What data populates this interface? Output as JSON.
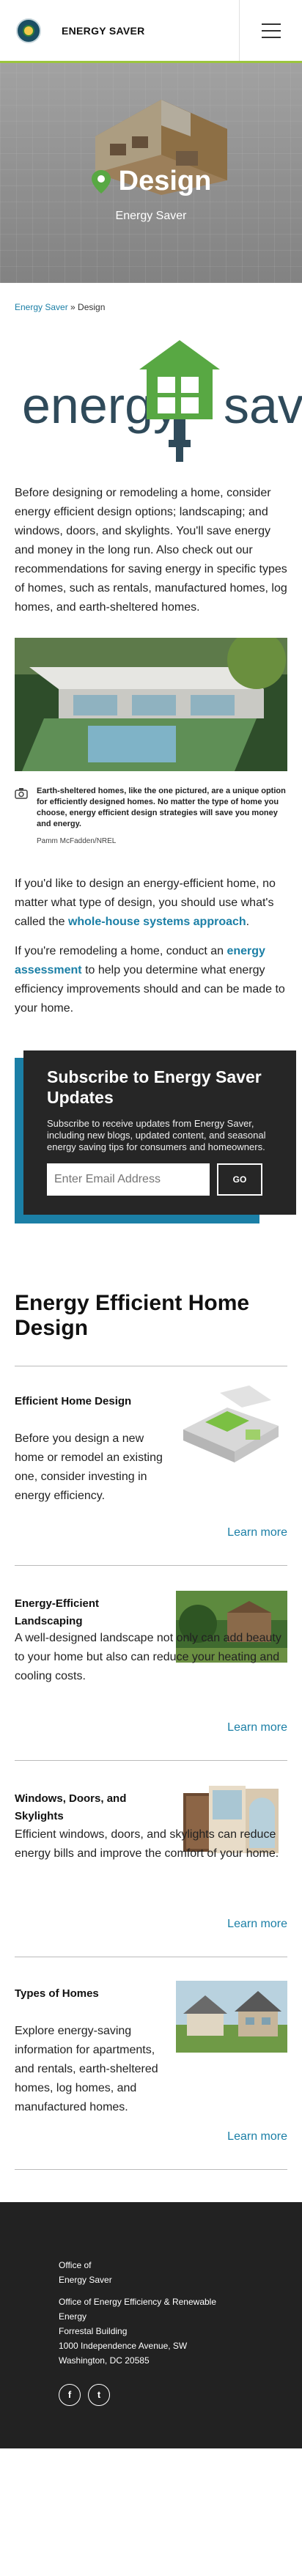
{
  "header": {
    "site_name": "ENERGY SAVER",
    "menu_icon": "hamburger-icon"
  },
  "hero": {
    "title": "Design",
    "subtitle": "Energy Saver",
    "icon": "map-pin-icon"
  },
  "breadcrumb": {
    "home": "Energy Saver",
    "separator": " » ",
    "current": "Design"
  },
  "logo": {
    "text_left": "energy",
    "text_right": "sav"
  },
  "intro": "Before designing or remodeling a home, consider energy efficient design options; landscaping; and windows, doors, and skylights. You'll save energy and money in the long run. Also check out our recommendations for saving energy in specific types of homes, such as rentals, manufactured homes, log homes, and earth-sheltered homes.",
  "photo": {
    "caption": "Earth-sheltered homes, like the one pictured, are a unique option for efficiently designed homes. No matter the type of home you choose, energy efficient design strategies will save you money and energy.",
    "credit": "Pamm McFadden/NREL"
  },
  "para2": {
    "before": "If you'd like to design an energy-efficient home, no matter what type of design, you should use what's called the ",
    "link": "whole-house systems approach",
    "after": "."
  },
  "para3": {
    "before": "If you're remodeling a home, conduct an ",
    "link": "energy assessment",
    "after": " to help you determine what energy efficiency improvements should and can be made to your home."
  },
  "subscribe": {
    "title": "Subscribe to Energy Saver Updates",
    "text": "Subscribe to receive updates from Energy Saver, including new blogs, updated content, and seasonal energy saving tips for consumers and homeowners.",
    "placeholder": "Enter Email Address",
    "button": "GO"
  },
  "section_title": "Energy Efficient Home Design",
  "cards": [
    {
      "title": "Efficient Home Design",
      "desc": "Before you design a new home or remodel an existing one, consider investing in energy efficiency.",
      "link": "Learn more"
    },
    {
      "title": "Energy-Efficient Landscaping",
      "desc": "A well-designed landscape not only can add beauty to your home but also can reduce your heating and cooling costs.",
      "link": "Learn more"
    },
    {
      "title": "Windows, Doors, and Skylights",
      "desc": "Efficient windows, doors, and skylights can reduce energy bills and improve the comfort of your home.",
      "link": "Learn more"
    },
    {
      "title": "Types of Homes",
      "desc": "Explore energy-saving information for apartments, and rentals, earth-sheltered homes, log homes, and manufactured homes.",
      "link": "Learn more"
    }
  ],
  "footer": {
    "office": "Office of",
    "office_name": "Energy Saver",
    "parent": "Office of Energy Efficiency & Renewable Energy",
    "building": "Forrestal Building",
    "address": "1000 Independence Avenue, SW",
    "city": "Washington, DC 20585",
    "social": [
      "f",
      "t"
    ]
  },
  "colors": {
    "accent_green": "#9bc53d",
    "link_blue": "#1b7fa6",
    "logo_green": "#58a843",
    "dark": "#262626"
  }
}
